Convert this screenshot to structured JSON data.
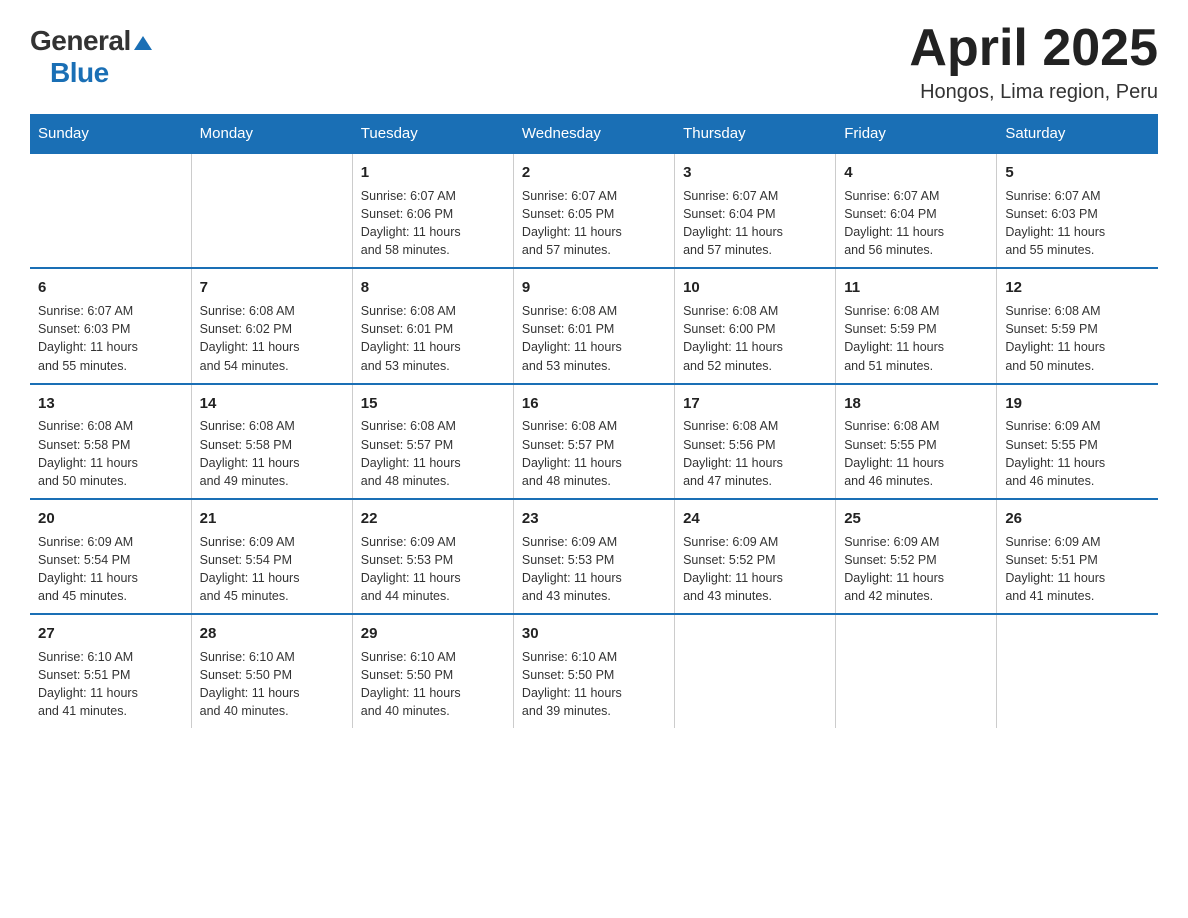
{
  "header": {
    "logo_general": "General",
    "logo_blue": "Blue",
    "title": "April 2025",
    "subtitle": "Hongos, Lima region, Peru"
  },
  "days_of_week": [
    "Sunday",
    "Monday",
    "Tuesday",
    "Wednesday",
    "Thursday",
    "Friday",
    "Saturday"
  ],
  "weeks": [
    [
      {
        "day": "",
        "info": ""
      },
      {
        "day": "",
        "info": ""
      },
      {
        "day": "1",
        "info": "Sunrise: 6:07 AM\nSunset: 6:06 PM\nDaylight: 11 hours\nand 58 minutes."
      },
      {
        "day": "2",
        "info": "Sunrise: 6:07 AM\nSunset: 6:05 PM\nDaylight: 11 hours\nand 57 minutes."
      },
      {
        "day": "3",
        "info": "Sunrise: 6:07 AM\nSunset: 6:04 PM\nDaylight: 11 hours\nand 57 minutes."
      },
      {
        "day": "4",
        "info": "Sunrise: 6:07 AM\nSunset: 6:04 PM\nDaylight: 11 hours\nand 56 minutes."
      },
      {
        "day": "5",
        "info": "Sunrise: 6:07 AM\nSunset: 6:03 PM\nDaylight: 11 hours\nand 55 minutes."
      }
    ],
    [
      {
        "day": "6",
        "info": "Sunrise: 6:07 AM\nSunset: 6:03 PM\nDaylight: 11 hours\nand 55 minutes."
      },
      {
        "day": "7",
        "info": "Sunrise: 6:08 AM\nSunset: 6:02 PM\nDaylight: 11 hours\nand 54 minutes."
      },
      {
        "day": "8",
        "info": "Sunrise: 6:08 AM\nSunset: 6:01 PM\nDaylight: 11 hours\nand 53 minutes."
      },
      {
        "day": "9",
        "info": "Sunrise: 6:08 AM\nSunset: 6:01 PM\nDaylight: 11 hours\nand 53 minutes."
      },
      {
        "day": "10",
        "info": "Sunrise: 6:08 AM\nSunset: 6:00 PM\nDaylight: 11 hours\nand 52 minutes."
      },
      {
        "day": "11",
        "info": "Sunrise: 6:08 AM\nSunset: 5:59 PM\nDaylight: 11 hours\nand 51 minutes."
      },
      {
        "day": "12",
        "info": "Sunrise: 6:08 AM\nSunset: 5:59 PM\nDaylight: 11 hours\nand 50 minutes."
      }
    ],
    [
      {
        "day": "13",
        "info": "Sunrise: 6:08 AM\nSunset: 5:58 PM\nDaylight: 11 hours\nand 50 minutes."
      },
      {
        "day": "14",
        "info": "Sunrise: 6:08 AM\nSunset: 5:58 PM\nDaylight: 11 hours\nand 49 minutes."
      },
      {
        "day": "15",
        "info": "Sunrise: 6:08 AM\nSunset: 5:57 PM\nDaylight: 11 hours\nand 48 minutes."
      },
      {
        "day": "16",
        "info": "Sunrise: 6:08 AM\nSunset: 5:57 PM\nDaylight: 11 hours\nand 48 minutes."
      },
      {
        "day": "17",
        "info": "Sunrise: 6:08 AM\nSunset: 5:56 PM\nDaylight: 11 hours\nand 47 minutes."
      },
      {
        "day": "18",
        "info": "Sunrise: 6:08 AM\nSunset: 5:55 PM\nDaylight: 11 hours\nand 46 minutes."
      },
      {
        "day": "19",
        "info": "Sunrise: 6:09 AM\nSunset: 5:55 PM\nDaylight: 11 hours\nand 46 minutes."
      }
    ],
    [
      {
        "day": "20",
        "info": "Sunrise: 6:09 AM\nSunset: 5:54 PM\nDaylight: 11 hours\nand 45 minutes."
      },
      {
        "day": "21",
        "info": "Sunrise: 6:09 AM\nSunset: 5:54 PM\nDaylight: 11 hours\nand 45 minutes."
      },
      {
        "day": "22",
        "info": "Sunrise: 6:09 AM\nSunset: 5:53 PM\nDaylight: 11 hours\nand 44 minutes."
      },
      {
        "day": "23",
        "info": "Sunrise: 6:09 AM\nSunset: 5:53 PM\nDaylight: 11 hours\nand 43 minutes."
      },
      {
        "day": "24",
        "info": "Sunrise: 6:09 AM\nSunset: 5:52 PM\nDaylight: 11 hours\nand 43 minutes."
      },
      {
        "day": "25",
        "info": "Sunrise: 6:09 AM\nSunset: 5:52 PM\nDaylight: 11 hours\nand 42 minutes."
      },
      {
        "day": "26",
        "info": "Sunrise: 6:09 AM\nSunset: 5:51 PM\nDaylight: 11 hours\nand 41 minutes."
      }
    ],
    [
      {
        "day": "27",
        "info": "Sunrise: 6:10 AM\nSunset: 5:51 PM\nDaylight: 11 hours\nand 41 minutes."
      },
      {
        "day": "28",
        "info": "Sunrise: 6:10 AM\nSunset: 5:50 PM\nDaylight: 11 hours\nand 40 minutes."
      },
      {
        "day": "29",
        "info": "Sunrise: 6:10 AM\nSunset: 5:50 PM\nDaylight: 11 hours\nand 40 minutes."
      },
      {
        "day": "30",
        "info": "Sunrise: 6:10 AM\nSunset: 5:50 PM\nDaylight: 11 hours\nand 39 minutes."
      },
      {
        "day": "",
        "info": ""
      },
      {
        "day": "",
        "info": ""
      },
      {
        "day": "",
        "info": ""
      }
    ]
  ]
}
